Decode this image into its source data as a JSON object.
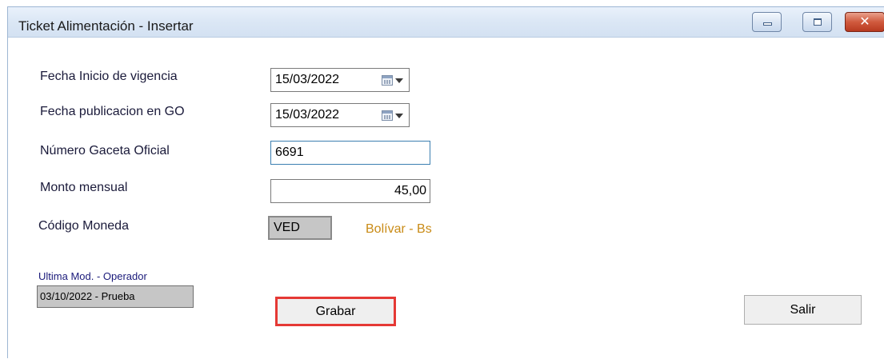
{
  "window": {
    "title": "Ticket Alimentación - Insertar",
    "controls": {
      "minimize": "minimize-icon",
      "maximize": "maximize-icon",
      "close": "close-icon",
      "close_glyph": "✕"
    }
  },
  "form": {
    "fecha_inicio": {
      "label": "Fecha Inicio de vigencia",
      "value": "15/03/2022"
    },
    "fecha_publicacion": {
      "label": "Fecha publicacion en GO",
      "value": "15/03/2022"
    },
    "numero_gaceta": {
      "label": "Número Gaceta Oficial",
      "value": "6691"
    },
    "monto_mensual": {
      "label": "Monto mensual",
      "value": "45,00"
    },
    "codigo_moneda": {
      "label": "Código Moneda",
      "value": "VED",
      "description": "Bolívar - Bs"
    },
    "ultima_mod": {
      "label": "Ultima Mod. - Operador",
      "value": "03/10/2022 - Prueba"
    }
  },
  "buttons": {
    "grabar": "Grabar",
    "salir": "Salir"
  },
  "colors": {
    "currency_description": "#c98b16",
    "highlight_border": "#e53935",
    "focus_border": "#3c7fb1"
  }
}
